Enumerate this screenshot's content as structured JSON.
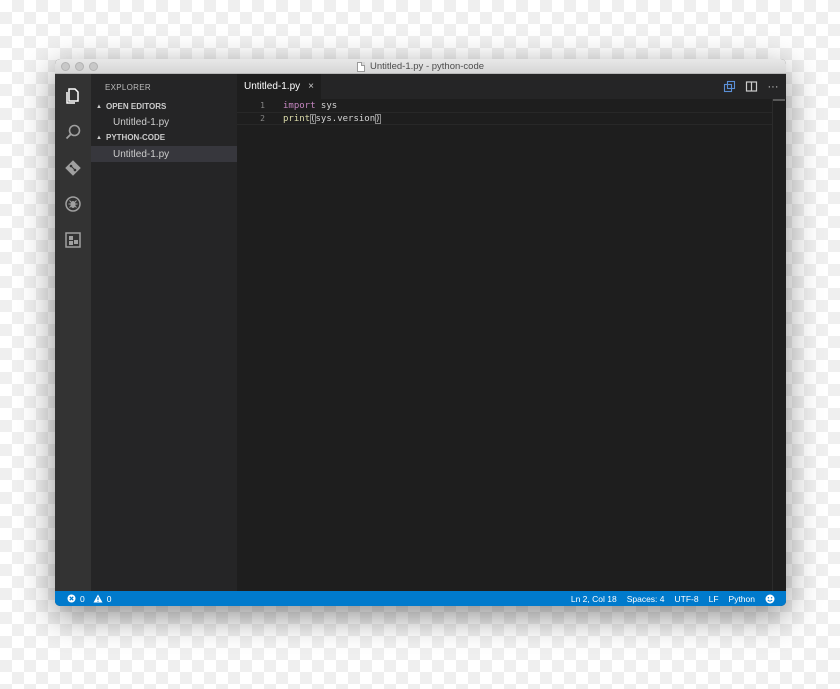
{
  "window": {
    "title": "Untitled-1.py - python-code"
  },
  "activitybar": {
    "icons": [
      "explorer-icon",
      "search-icon",
      "git-icon",
      "debug-icon",
      "extensions-icon"
    ]
  },
  "sidebar": {
    "title": "EXPLORER",
    "sections": [
      {
        "label": "OPEN EDITORS",
        "items": [
          "Untitled-1.py"
        ]
      },
      {
        "label": "PYTHON-CODE",
        "items": [
          "Untitled-1.py"
        ]
      }
    ]
  },
  "tabs": [
    {
      "label": "Untitled-1.py",
      "close": "×"
    }
  ],
  "tab_actions": [
    "open-changes-icon",
    "split-editor-icon",
    "more-icon"
  ],
  "tab_action_glyphs": {
    "more": "···"
  },
  "editor": {
    "lines": [
      {
        "number": "1",
        "keyword": "import",
        "rest": " sys"
      },
      {
        "number": "2",
        "func": "print",
        "open": "(",
        "args": "sys.version",
        "close": ")"
      }
    ]
  },
  "statusbar": {
    "errors": "0",
    "warnings": "0",
    "position": "Ln 2, Col 18",
    "spaces": "Spaces: 4",
    "encoding": "UTF-8",
    "eol": "LF",
    "language": "Python"
  },
  "colors": {
    "statusbar": "#007acc",
    "activitybar": "#333333",
    "sidebar": "#252526",
    "editor": "#1e1e1e",
    "keyword": "#c586c0",
    "function": "#dcdcaa"
  }
}
